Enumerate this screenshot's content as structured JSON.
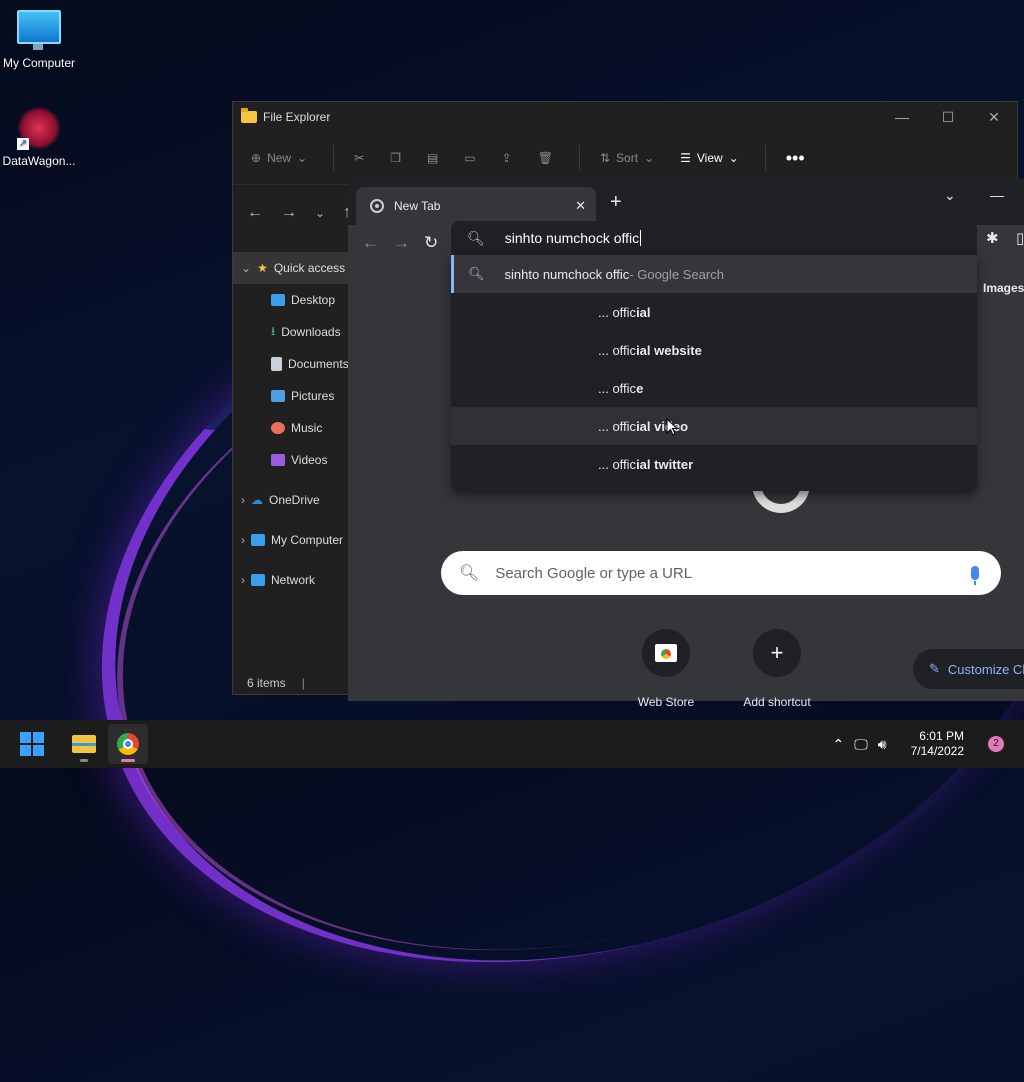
{
  "desktop": {
    "icons": [
      {
        "label": "My Computer"
      },
      {
        "label": "DataWagon..."
      }
    ]
  },
  "explorer": {
    "title": "File Explorer",
    "toolbar": {
      "new_label": "New",
      "sort_label": "Sort",
      "view_label": "View"
    },
    "sidebar": [
      {
        "label": "Quick access",
        "icon": "star-icon"
      },
      {
        "label": "Desktop",
        "icon": "desktop-icon"
      },
      {
        "label": "Downloads",
        "icon": "download-icon"
      },
      {
        "label": "Documents",
        "icon": "document-icon"
      },
      {
        "label": "Pictures",
        "icon": "pictures-icon"
      },
      {
        "label": "Music",
        "icon": "music-icon"
      },
      {
        "label": "Videos",
        "icon": "videos-icon"
      },
      {
        "label": "OneDrive",
        "icon": "cloud-icon"
      },
      {
        "label": "My Computer",
        "icon": "monitor-icon"
      },
      {
        "label": "Network",
        "icon": "network-icon"
      }
    ],
    "status": "6 items"
  },
  "chrome": {
    "tab_title": "New Tab",
    "omnibox_text": "sinhto numchock offic",
    "suggestions": {
      "first": {
        "query": "sinhto numchock offic",
        "suffix": " - Google Search"
      },
      "items": [
        {
          "prefix": "... offic",
          "bold": "ial"
        },
        {
          "prefix": "... offic",
          "bold": "ial website"
        },
        {
          "prefix": "... offic",
          "bold": "e"
        },
        {
          "prefix": "... offic",
          "bold": "ial video"
        },
        {
          "prefix": "... offic",
          "bold": "ial twitter"
        }
      ]
    },
    "ntp": {
      "images_link": "Images",
      "search_placeholder": "Search Google or type a URL",
      "shortcuts": [
        {
          "label": "Web Store"
        },
        {
          "label": "Add shortcut"
        }
      ],
      "customize_label": "Customize Chrome"
    }
  },
  "taskbar": {
    "time": "6:01 PM",
    "date": "7/14/2022",
    "notification_count": "2"
  },
  "colors": {
    "accent": "#8ab4f8",
    "taskbar_badge": "#e07ab8"
  }
}
